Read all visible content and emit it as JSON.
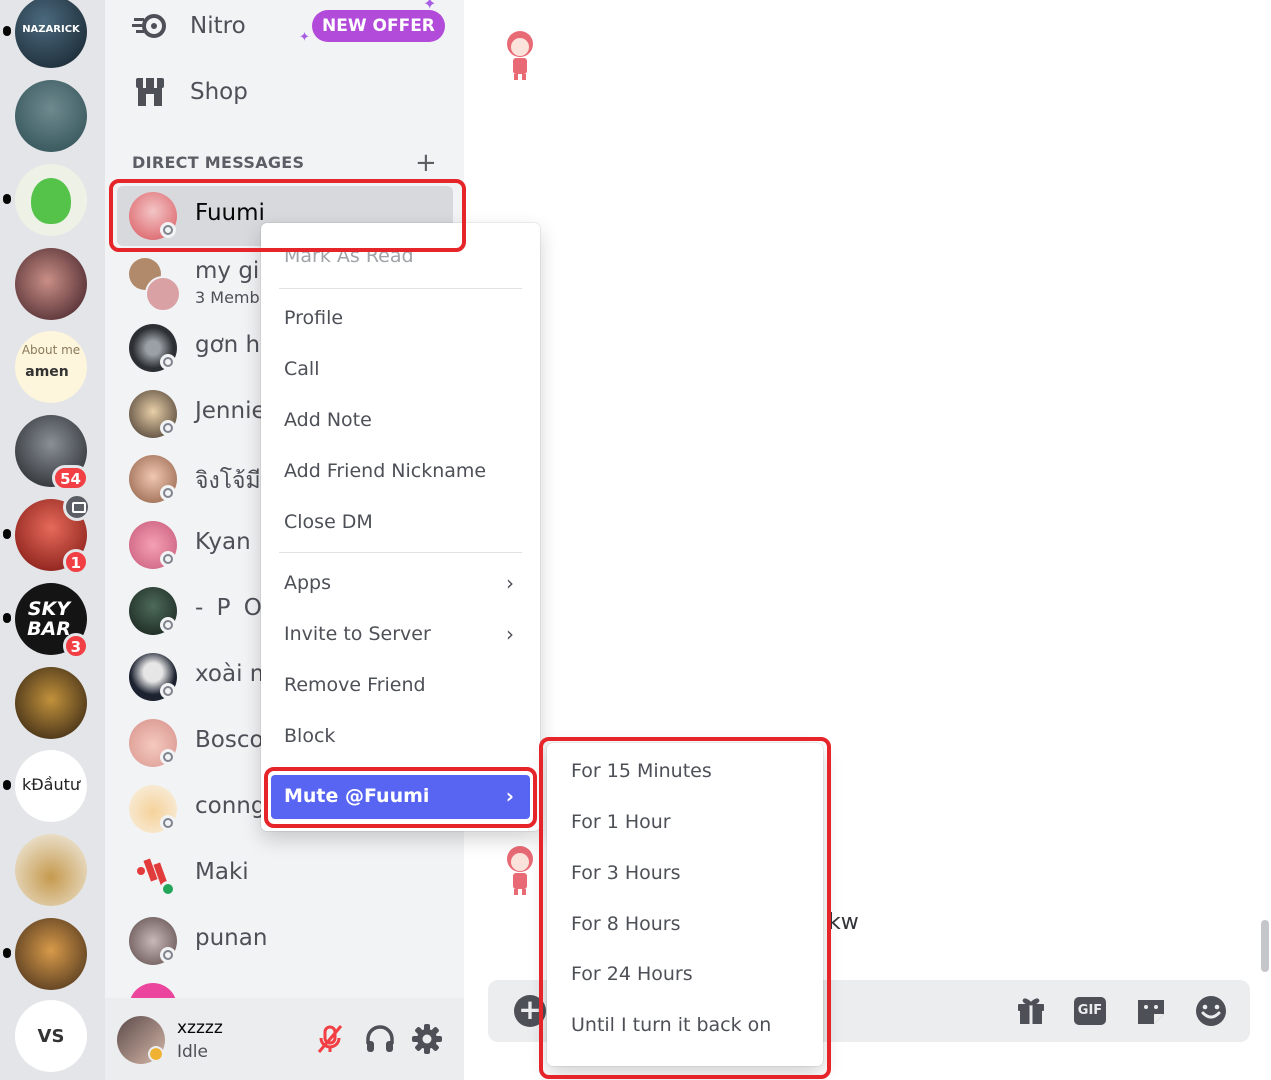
{
  "servers": [
    {
      "label": "NAZARICK",
      "badge": ""
    },
    {
      "label": "",
      "badge": ""
    },
    {
      "label": "",
      "badge": ""
    },
    {
      "label": "",
      "badge": ""
    },
    {
      "label": "About me",
      "label2": "amen",
      "badge": ""
    },
    {
      "label": "",
      "badge": "54"
    },
    {
      "label": "",
      "badge": "1"
    },
    {
      "label": "SKY BAR",
      "badge": "3"
    },
    {
      "label": "",
      "badge": ""
    },
    {
      "label": "kĐầutư",
      "badge": ""
    },
    {
      "label": "",
      "badge": ""
    },
    {
      "label": "",
      "badge": ""
    },
    {
      "label": "VS",
      "badge": ""
    }
  ],
  "sidebar": {
    "nitro_label": "Nitro",
    "nitro_offer": "NEW OFFER",
    "shop_label": "Shop",
    "dm_header": "DIRECT MESSAGES",
    "dm_add": "+",
    "dms": [
      {
        "name": "Fuumi",
        "sub": ""
      },
      {
        "name": "my girl",
        "sub": "3 Memb"
      },
      {
        "name": "gơn hà",
        "sub": ""
      },
      {
        "name": "Jennie",
        "sub": ""
      },
      {
        "name": "จิงโจ้มี",
        "sub": ""
      },
      {
        "name": "Kyan",
        "sub": ""
      },
      {
        "name": "- P O P",
        "sub": ""
      },
      {
        "name": "xoài m",
        "sub": ""
      },
      {
        "name": "Bosco",
        "sub": ""
      },
      {
        "name": "conngu",
        "sub": ""
      },
      {
        "name": "Maki",
        "sub": ""
      },
      {
        "name": "punan",
        "sub": ""
      }
    ]
  },
  "user": {
    "name": "xzzzz",
    "status": "Idle"
  },
  "chat": {
    "fragment": "kw"
  },
  "context_menu": {
    "mark_as_read": "Mark As Read",
    "profile": "Profile",
    "call": "Call",
    "add_note": "Add Note",
    "add_friend_nickname": "Add Friend Nickname",
    "close_dm": "Close DM",
    "apps": "Apps",
    "invite_to_server": "Invite to Server",
    "remove_friend": "Remove Friend",
    "block": "Block",
    "mute": "Mute @Fuumi"
  },
  "mute_submenu": [
    "For 15 Minutes",
    "For 1 Hour",
    "For 3 Hours",
    "For 8 Hours",
    "For 24 Hours",
    "Until I turn it back on"
  ],
  "composer": {
    "gif_label": "GIF"
  },
  "colors": {
    "accent": "#5865f2",
    "annotation": "#e5252a",
    "offer": "#b24bd9",
    "badge": "#f23f43"
  }
}
